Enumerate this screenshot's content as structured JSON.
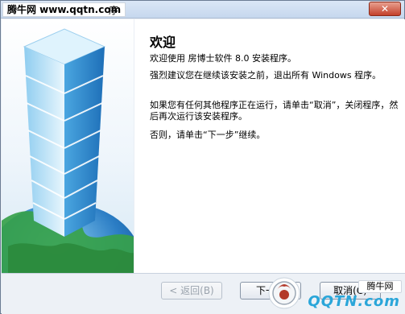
{
  "window": {
    "title_watermark": "腾牛网 www.qqtn.com",
    "title_suffix": "序",
    "close_label": "✕"
  },
  "main": {
    "heading": "欢迎",
    "paragraphs": [
      "欢迎使用 房博士软件 8.0 安装程序。",
      "强烈建议您在继续该安装之前，退出所有 Windows 程序。",
      "如果您有任何其他程序正在运行，请单击“取消”，关闭程序，然后再次运行该安装程序。",
      "否则，请单击“下一步”继续。"
    ]
  },
  "buttons": {
    "back": "< 返回(B)",
    "next": "下一步",
    "cancel": "取消(C)"
  },
  "watermarks": {
    "bottom_right": "腾牛网",
    "logo_text": "QQTN.com"
  },
  "colors": {
    "tower_light": "#bfe4f7",
    "tower_dark": "#3f95d3",
    "globe_green": "#36a14a",
    "globe_blue": "#2a7cc4",
    "qqtn_blue": "#2aa6d9"
  }
}
